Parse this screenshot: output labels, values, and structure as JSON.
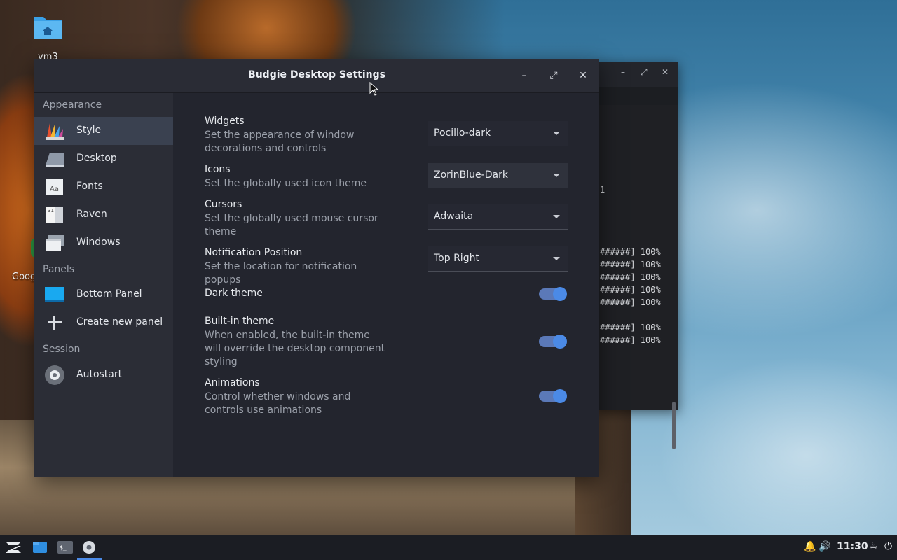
{
  "desktop": {
    "icons": [
      {
        "label": "vm3"
      },
      {
        "label": "Goog"
      }
    ]
  },
  "terminal": {
    "lines": [
      "1",
      "######] 100%",
      "######] 100%",
      "######] 100%",
      "######] 100%",
      "######] 100%",
      "######] 100%",
      "######] 100%"
    ]
  },
  "window": {
    "title": "Budgie Desktop Settings"
  },
  "sidebar": {
    "sections": [
      {
        "header": "Appearance"
      },
      {
        "header": "Panels"
      },
      {
        "header": "Session"
      }
    ],
    "items": [
      {
        "label": "Style",
        "icon": "style-icon"
      },
      {
        "label": "Desktop",
        "icon": "desktop-icon"
      },
      {
        "label": "Fonts",
        "icon": "fonts-icon"
      },
      {
        "label": "Raven",
        "icon": "raven-icon"
      },
      {
        "label": "Windows",
        "icon": "windows-icon"
      },
      {
        "label": "Bottom Panel",
        "icon": "panel-icon"
      },
      {
        "label": "Create new panel",
        "icon": "plus-icon"
      },
      {
        "label": "Autostart",
        "icon": "gear-icon"
      }
    ]
  },
  "settings": {
    "widgets": {
      "title": "Widgets",
      "desc": "Set the appearance of window decorations and controls",
      "value": "Pocillo-dark"
    },
    "icons": {
      "title": "Icons",
      "desc": "Set the globally used icon theme",
      "value": "ZorinBlue-Dark"
    },
    "cursors": {
      "title": "Cursors",
      "desc": "Set the globally used mouse cursor theme",
      "value": "Adwaita"
    },
    "notification": {
      "title": "Notification Position",
      "desc": "Set the location for notification popups",
      "value": "Top Right"
    },
    "dark_theme": {
      "title": "Dark theme",
      "on": true
    },
    "builtin_theme": {
      "title": "Built-in theme",
      "desc": "When enabled, the built-in theme will override the desktop component styling",
      "on": true
    },
    "animations": {
      "title": "Animations",
      "desc": "Control whether windows and controls use animations",
      "on": true
    }
  },
  "taskbar": {
    "clock": "11:30"
  },
  "colors": {
    "accent": "#4b8ae6",
    "sidebar_active": "#3a4150"
  }
}
